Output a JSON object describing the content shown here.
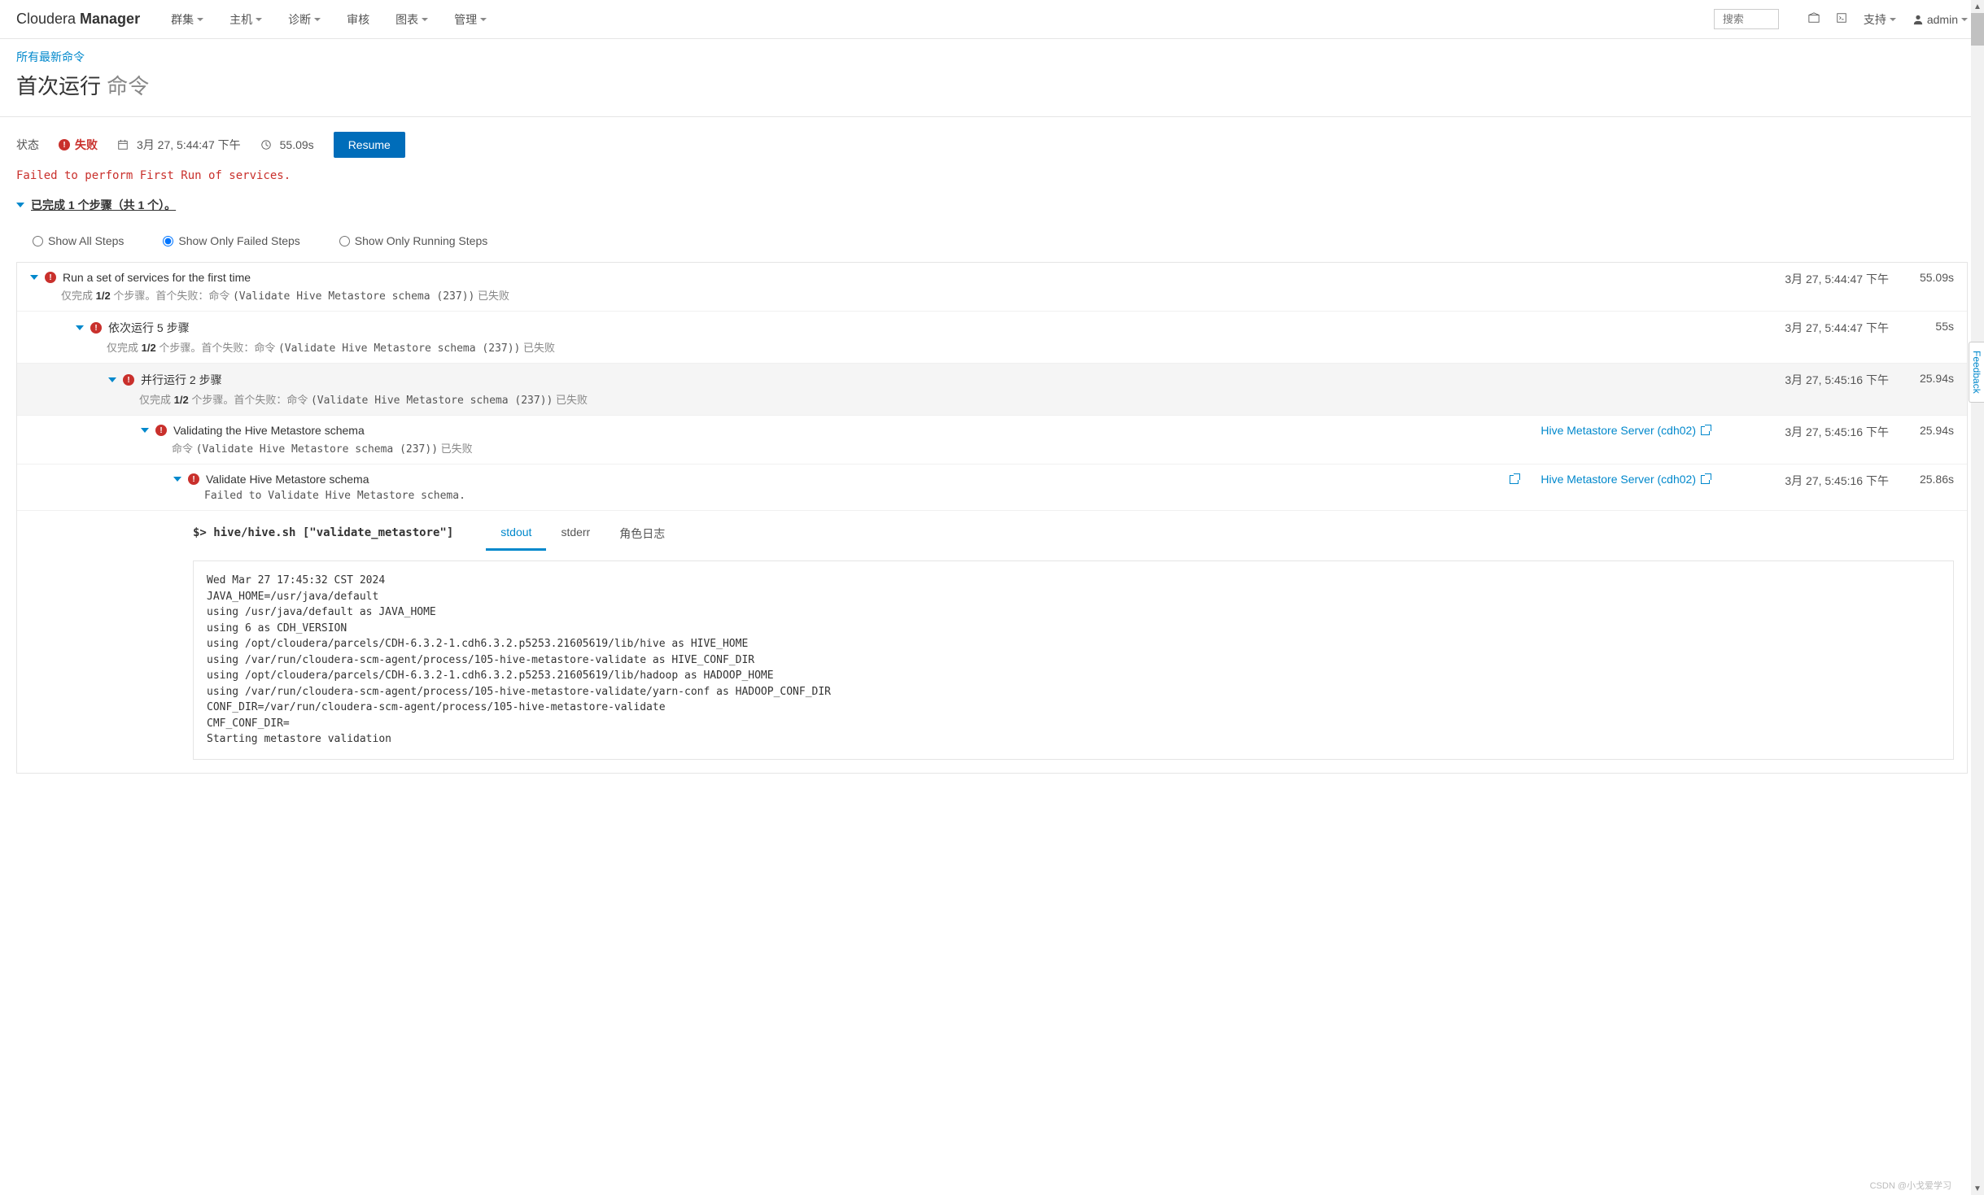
{
  "header": {
    "logo_plain": "Cloudera ",
    "logo_bold": "Manager",
    "nav": [
      "群集",
      "主机",
      "诊断",
      "审核",
      "图表",
      "管理"
    ],
    "search_placeholder": "搜索",
    "support": "支持",
    "user": "admin"
  },
  "breadcrumb": "所有最新命令",
  "title_main": "首次运行",
  "title_sub": " 命令",
  "status": {
    "label": "状态",
    "failed": "失败",
    "datetime": "3月 27, 5:44:47 下午",
    "duration": "55.09s",
    "resume": "Resume"
  },
  "error_message": "Failed to perform First Run of services.",
  "completed_text": "已完成 1 个步骤（共 1 个）。",
  "filters": {
    "all": "Show All Steps",
    "failed": "Show Only Failed Steps",
    "running": "Show Only Running Steps"
  },
  "steps": [
    {
      "title": "Run a set of services for the first time",
      "sub_prefix": "仅完成 ",
      "sub_count": "1/2",
      "sub_mid": " 个步骤。首个失败：命令 ",
      "sub_mono": "(Validate Hive Metastore schema (237))",
      "sub_suffix": " 已失败",
      "time": "3月 27, 5:44:47 下午",
      "dur": "55.09s",
      "indent": 0
    },
    {
      "title": "依次运行 5 步骤",
      "sub_prefix": "仅完成 ",
      "sub_count": "1/2",
      "sub_mid": " 个步骤。首个失败：命令 ",
      "sub_mono": "(Validate Hive Metastore schema (237))",
      "sub_suffix": " 已失败",
      "time": "3月 27, 5:44:47 下午",
      "dur": "55s",
      "indent": 1
    },
    {
      "title": "并行运行 2 步骤",
      "sub_prefix": "仅完成 ",
      "sub_count": "1/2",
      "sub_mid": " 个步骤。首个失败：命令 ",
      "sub_mono": "(Validate Hive Metastore schema (237))",
      "sub_suffix": " 已失败",
      "time": "3月 27, 5:45:16 下午",
      "dur": "25.94s",
      "indent": 2,
      "highlighted": true
    },
    {
      "title": "Validating the Hive Metastore schema",
      "sub_prefix": "命令 ",
      "sub_mono": "(Validate Hive Metastore schema (237))",
      "sub_suffix": " 已失败",
      "link": "Hive Metastore Server (cdh02)",
      "time": "3月 27, 5:45:16 下午",
      "dur": "25.94s",
      "indent": 3
    },
    {
      "title": "Validate Hive Metastore schema",
      "sub_mono_full": "Failed to Validate Hive Metastore schema.",
      "link": "Hive Metastore Server (cdh02)",
      "has_ext_left": true,
      "time": "3月 27, 5:45:16 下午",
      "dur": "25.86s",
      "indent": 4
    }
  ],
  "command": "$> hive/hive.sh [\"validate_metastore\"]",
  "tabs": [
    "stdout",
    "stderr",
    "角色日志"
  ],
  "output": "Wed Mar 27 17:45:32 CST 2024\nJAVA_HOME=/usr/java/default\nusing /usr/java/default as JAVA_HOME\nusing 6 as CDH_VERSION\nusing /opt/cloudera/parcels/CDH-6.3.2-1.cdh6.3.2.p5253.21605619/lib/hive as HIVE_HOME\nusing /var/run/cloudera-scm-agent/process/105-hive-metastore-validate as HIVE_CONF_DIR\nusing /opt/cloudera/parcels/CDH-6.3.2-1.cdh6.3.2.p5253.21605619/lib/hadoop as HADOOP_HOME\nusing /var/run/cloudera-scm-agent/process/105-hive-metastore-validate/yarn-conf as HADOOP_CONF_DIR\nCONF_DIR=/var/run/cloudera-scm-agent/process/105-hive-metastore-validate\nCMF_CONF_DIR=\nStarting metastore validation",
  "feedback": "Feedback",
  "watermark": "CSDN @小戈爱学习"
}
